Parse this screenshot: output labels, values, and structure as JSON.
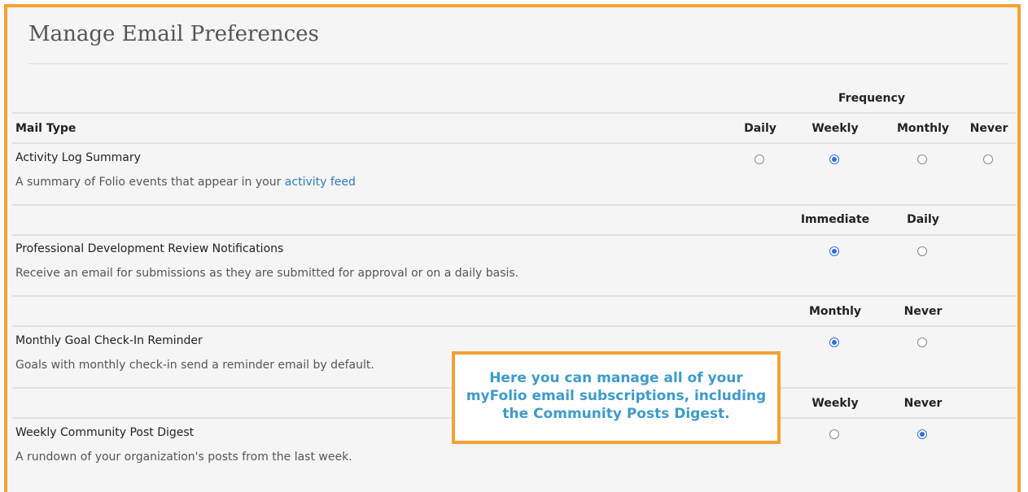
{
  "page": {
    "title": "Manage Email Preferences"
  },
  "table": {
    "group_header": "Frequency",
    "mail_type_header": "Mail Type",
    "main_columns": [
      "Daily",
      "Weekly",
      "Monthly",
      "Never"
    ],
    "rows": [
      {
        "name": "Activity Log Summary",
        "description_prefix": "A summary of Folio events that appear in your ",
        "description_link": "activity feed",
        "options": [
          "Daily",
          "Weekly",
          "Monthly",
          "Never"
        ],
        "selected": "Weekly"
      },
      {
        "name": "Professional Development Review Notifications",
        "description": "Receive an email for submissions as they are submitted for approval or on a daily basis.",
        "options": [
          "Immediate",
          "Daily"
        ],
        "selected": "Immediate"
      },
      {
        "name": "Monthly Goal Check-In Reminder",
        "description": "Goals with monthly check-in send a reminder email by default.",
        "options": [
          "Monthly",
          "Never"
        ],
        "selected": "Monthly"
      },
      {
        "name": "Weekly Community Post Digest",
        "description": "A rundown of your organization's posts from the last week.",
        "options": [
          "Weekly",
          "Never"
        ],
        "selected": "Never"
      }
    ]
  },
  "callout": {
    "lines": [
      "Here you can manage all of your",
      "myFolio email subscriptions, including",
      "the Community Posts Digest."
    ]
  },
  "colors": {
    "accent_border": "#f3a233",
    "callout_text": "#3e9bc9",
    "link": "#2a7ab8",
    "radio_selected": "#2f6fe0"
  }
}
